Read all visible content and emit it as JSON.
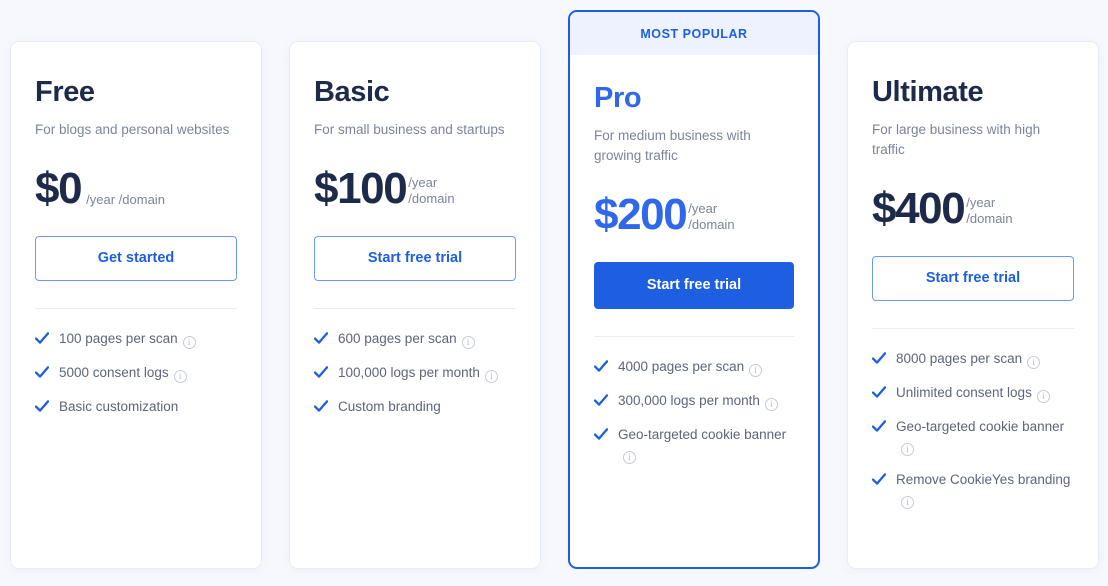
{
  "theme": {
    "page_background": "#f7f8fd",
    "accent": "#1d5fe0",
    "heading": "#1e2a4a",
    "muted_text": "#7c8499"
  },
  "plans": [
    {
      "id": "free",
      "name": "Free",
      "description": "For blogs and\npersonal websites",
      "price": "$0",
      "unit": "/year /domain",
      "unit_inline": true,
      "cta_label": "Get started",
      "featured": false,
      "badge": null,
      "features": [
        {
          "label": "100 pages per scan",
          "info": true
        },
        {
          "label": "5000 consent logs",
          "info": true
        },
        {
          "label": "Basic customization",
          "info": false
        }
      ]
    },
    {
      "id": "basic",
      "name": "Basic",
      "description": "For small business\nand startups",
      "price": "$100",
      "unit": "/year\n/domain",
      "unit_inline": false,
      "cta_label": "Start free trial",
      "featured": false,
      "badge": null,
      "features": [
        {
          "label": "600 pages per scan",
          "info": true
        },
        {
          "label": "100,000 logs per month",
          "info": true
        },
        {
          "label": "Custom branding",
          "info": false
        }
      ]
    },
    {
      "id": "pro",
      "name": "Pro",
      "description": "For medium business\nwith growing traffic",
      "price": "$200",
      "unit": "/year\n/domain",
      "unit_inline": false,
      "cta_label": "Start free trial",
      "featured": true,
      "badge": "MOST POPULAR",
      "features": [
        {
          "label": "4000 pages per scan",
          "info": true
        },
        {
          "label": "300,000 logs per month",
          "info": true
        },
        {
          "label": "Geo-targeted cookie banner",
          "info": true
        }
      ]
    },
    {
      "id": "ultimate",
      "name": "Ultimate",
      "description": "For large business\nwith high traffic",
      "price": "$400",
      "unit": "/year\n/domain",
      "unit_inline": false,
      "cta_label": "Start free trial",
      "featured": false,
      "badge": null,
      "features": [
        {
          "label": "8000 pages per scan",
          "info": true
        },
        {
          "label": "Unlimited consent logs",
          "info": true
        },
        {
          "label": "Geo-targeted cookie banner",
          "info": true
        },
        {
          "label": "Remove CookieYes branding",
          "info": true
        }
      ]
    }
  ],
  "icons": {
    "check": "check-icon",
    "info": "info-icon",
    "info_glyph": "i"
  }
}
